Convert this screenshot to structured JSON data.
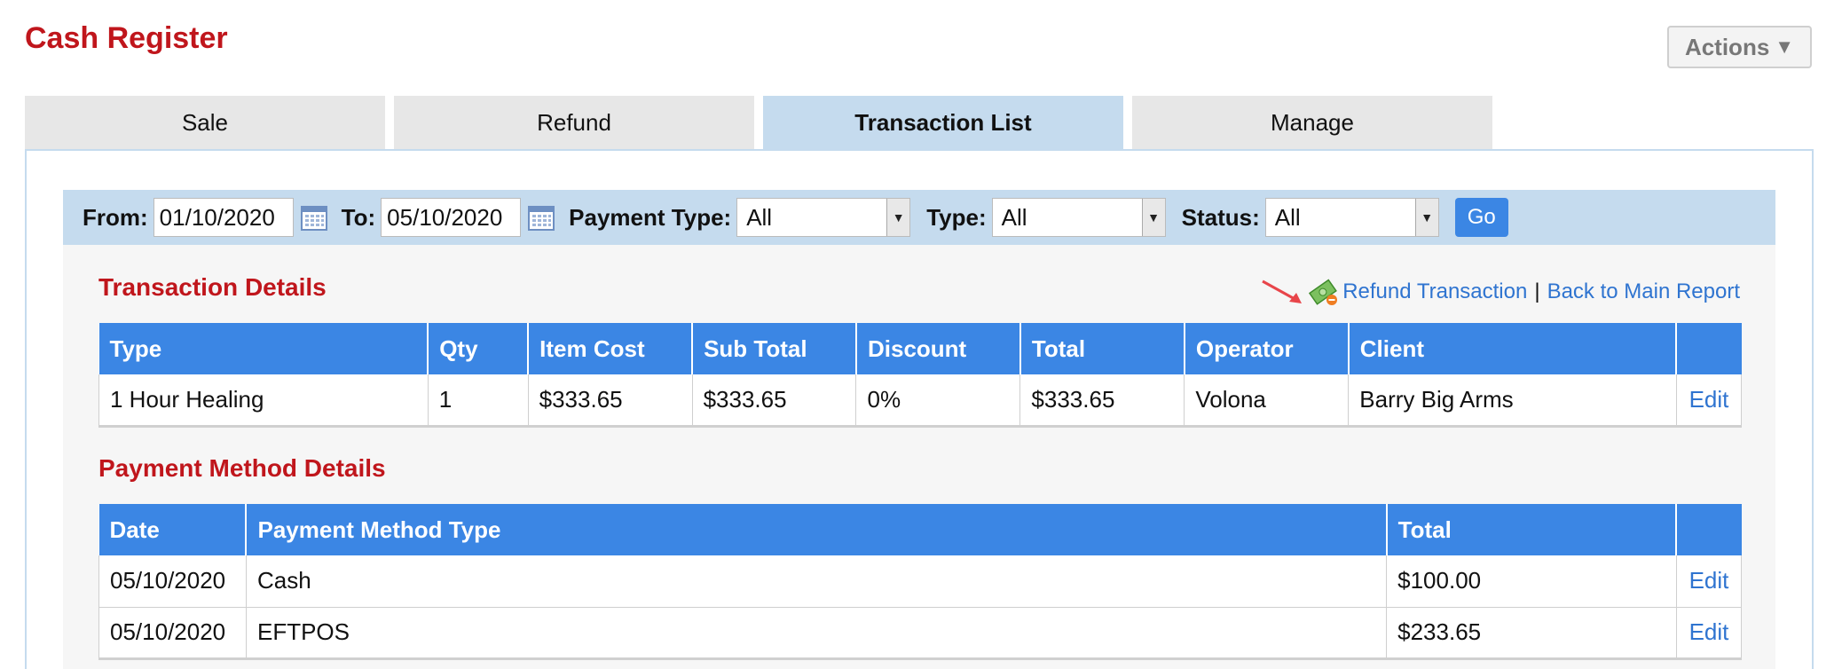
{
  "page": {
    "title": "Cash Register",
    "actions_label": "Actions"
  },
  "tabs": [
    {
      "label": "Sale",
      "active": false
    },
    {
      "label": "Refund",
      "active": false
    },
    {
      "label": "Transaction List",
      "active": true
    },
    {
      "label": "Manage",
      "active": false
    }
  ],
  "filters": {
    "from_label": "From:",
    "from_value": "01/10/2020",
    "to_label": "To:",
    "to_value": "05/10/2020",
    "payment_type_label": "Payment Type:",
    "payment_type_value": "All",
    "type_label": "Type:",
    "type_value": "All",
    "status_label": "Status:",
    "status_value": "All",
    "go_label": "Go"
  },
  "links": {
    "refund": "Refund Transaction",
    "separator": "|",
    "back": "Back to Main Report"
  },
  "transaction_details": {
    "title": "Transaction Details",
    "columns": [
      "Type",
      "Qty",
      "Item Cost",
      "Sub Total",
      "Discount",
      "Total",
      "Operator",
      "Client",
      ""
    ],
    "rows": [
      [
        "1 Hour Healing",
        "1",
        "$333.65",
        "$333.65",
        "0%",
        "$333.65",
        "Volona",
        "Barry Big Arms",
        "Edit"
      ]
    ]
  },
  "payment_details": {
    "title": "Payment Method Details",
    "columns": [
      "Date",
      "Payment Method Type",
      "Total",
      ""
    ],
    "rows": [
      [
        "05/10/2020",
        "Cash",
        "$100.00",
        "Edit"
      ],
      [
        "05/10/2020",
        "EFTPOS",
        "$233.65",
        "Edit"
      ]
    ]
  },
  "colors": {
    "title_red": "#c0161c",
    "header_blue": "#3b86e4",
    "tab_active": "#c5dbee",
    "link_blue": "#2f74d0"
  }
}
